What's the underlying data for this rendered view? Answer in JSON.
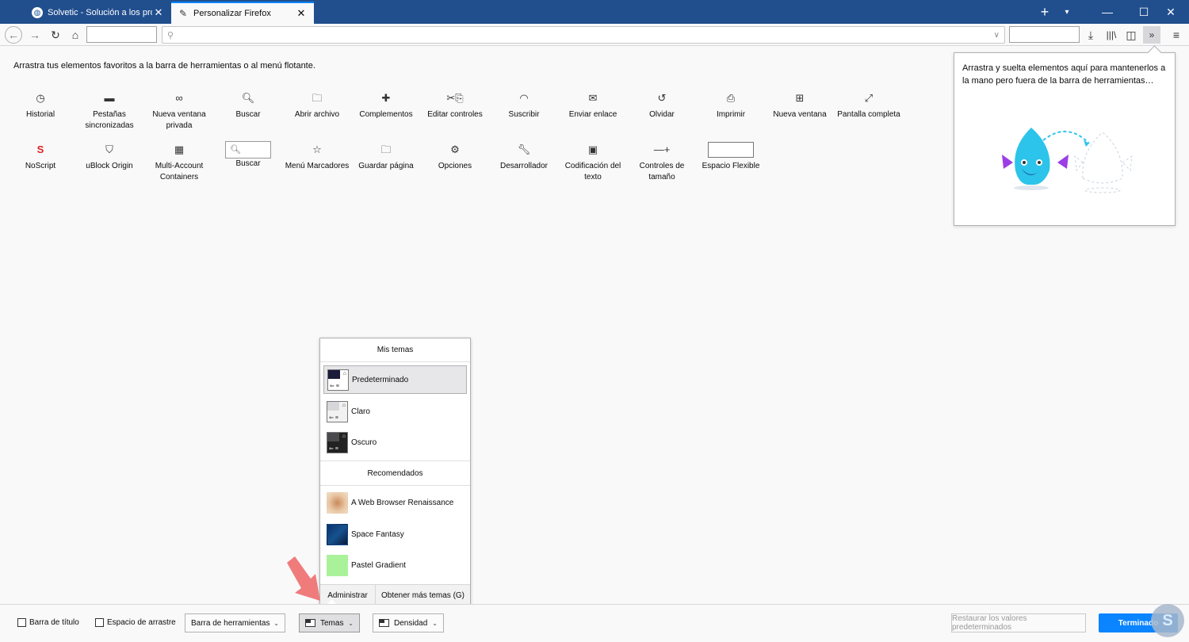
{
  "tabs": [
    {
      "label": "Solvetic - Solución a los problemas",
      "active": false
    },
    {
      "label": "Personalizar Firefox",
      "active": true
    }
  ],
  "hint": "Arrastra tus elementos favoritos a la barra de herramientas o al menú flotante.",
  "palette": [
    {
      "label": "Historial",
      "icon": "clock-icon",
      "glyph": "◷"
    },
    {
      "label": "Pestañas sincronizadas",
      "icon": "laptop-icon",
      "glyph": "▬"
    },
    {
      "label": "Nueva ventana privada",
      "icon": "mask-icon",
      "glyph": "∞"
    },
    {
      "label": "Buscar",
      "icon": "search-icon",
      "glyph": "🔍︎"
    },
    {
      "label": "Abrir archivo",
      "icon": "folder-open-icon",
      "glyph": "🗀"
    },
    {
      "label": "Complementos",
      "icon": "puzzle-icon",
      "glyph": "✚"
    },
    {
      "label": "Editar controles",
      "icon": "scissors-clipboard-icon",
      "glyph": "✂⎘"
    },
    {
      "label": "Suscribir",
      "icon": "rss-icon",
      "glyph": "◠"
    },
    {
      "label": "Enviar enlace",
      "icon": "envelope-icon",
      "glyph": "✉"
    },
    {
      "label": "Olvidar",
      "icon": "forget-icon",
      "glyph": "↺"
    },
    {
      "label": "Imprimir",
      "icon": "printer-icon",
      "glyph": "⎙"
    },
    {
      "label": "Nueva ventana",
      "icon": "new-window-icon",
      "glyph": "⊞"
    },
    {
      "label": "Pantalla completa",
      "icon": "fullscreen-icon",
      "glyph": "⤢"
    },
    {
      "label": "NoScript",
      "icon": "noscript-icon",
      "glyph": "S"
    },
    {
      "label": "uBlock Origin",
      "icon": "ublock-icon",
      "glyph": "⛉"
    },
    {
      "label": "Multi-Account Containers",
      "icon": "containers-icon",
      "glyph": "▦"
    },
    {
      "label": "Buscar",
      "icon": "search-box-icon",
      "glyph": "🔍︎"
    },
    {
      "label": "Menú Marcadores",
      "icon": "bookmark-star-icon",
      "glyph": "☆"
    },
    {
      "label": "Guardar página",
      "icon": "save-page-icon",
      "glyph": "🗀"
    },
    {
      "label": "Opciones",
      "icon": "gear-icon",
      "glyph": "⚙"
    },
    {
      "label": "Desarrollador",
      "icon": "wrench-icon",
      "glyph": "🔧︎"
    },
    {
      "label": "Codificación del texto",
      "icon": "text-encoding-icon",
      "glyph": "▣"
    },
    {
      "label": "Controles de tamaño",
      "icon": "zoom-controls-icon",
      "glyph": "—+"
    },
    {
      "label": "Espacio Flexible",
      "icon": "flexible-space-icon",
      "glyph": ""
    }
  ],
  "overflow_panel": {
    "text": "Arrastra y suelta elementos aquí para mantenerlos a la mano pero fuera de la barra de herramientas…"
  },
  "themes_panel": {
    "my_themes_header": "Mis temas",
    "my_themes": [
      {
        "label": "Predeterminado",
        "selected": true
      },
      {
        "label": "Claro",
        "selected": false
      },
      {
        "label": "Oscuro",
        "selected": false
      }
    ],
    "recommended_header": "Recomendados",
    "recommended": [
      {
        "label": "A Web Browser Renaissance"
      },
      {
        "label": "Space Fantasy"
      },
      {
        "label": "Pastel Gradient"
      }
    ],
    "manage_label": "Administrar",
    "get_more_label": "Obtener más temas (G)"
  },
  "footer": {
    "title_bar_label": "Barra de título",
    "drag_space_label": "Espacio de arrastre",
    "toolbars_label": "Barra de herramientas",
    "themes_label": "Temas",
    "density_label": "Densidad",
    "restore_label": "Restaurar los valores predeterminados",
    "done_label": "Terminado"
  },
  "colors": {
    "accent": "#0a84ff",
    "tabstrip": "#214f8e"
  }
}
